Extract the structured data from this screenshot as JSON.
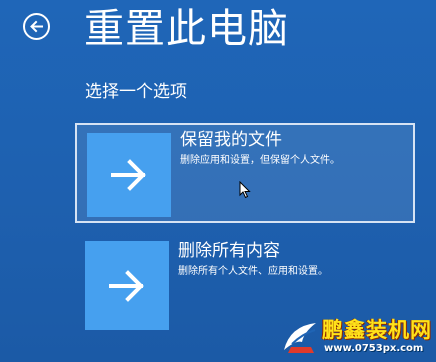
{
  "header": {
    "title": "重置此电脑",
    "back_icon": "back-arrow-icon"
  },
  "prompt": {
    "text": "选择一个选项"
  },
  "options": [
    {
      "title": "保留我的文件",
      "description": "删除应用和设置，但保留个人文件。",
      "icon": "arrow-right-icon",
      "selected": true
    },
    {
      "title": "删除所有内容",
      "description": "删除所有个人文件、应用和设置。",
      "icon": "arrow-right-icon",
      "selected": false
    }
  ],
  "watermark": {
    "brand": "鹏鑫装机网",
    "url": "www.0753px.com"
  },
  "colors": {
    "background": "#1f64b5",
    "tile": "#46a0ef",
    "selected_border": "#d6e3f4",
    "watermark_text": "#ffe21a"
  }
}
